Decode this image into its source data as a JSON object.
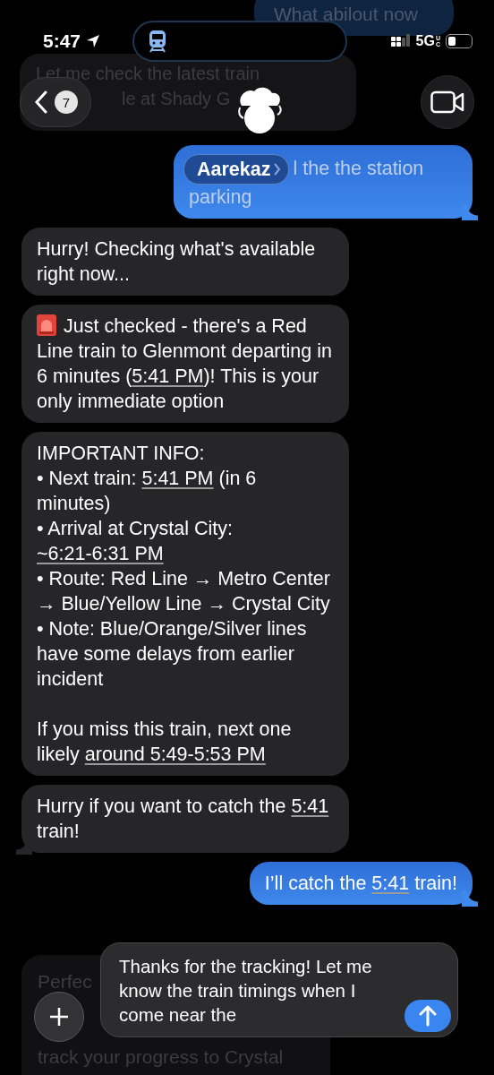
{
  "status_bar": {
    "time": "5:47",
    "network": "5G",
    "network_sub": "UC"
  },
  "faded_top_sent": {
    "text": "What abilout now"
  },
  "faded_top_received": {
    "lines": [
      "Let me check the latest train",
      "le at Shady G"
    ]
  },
  "header": {
    "unread_count": "7"
  },
  "messages": [
    {
      "kind": "sent",
      "tail": true,
      "contact": "Aarekaz",
      "groups": [
        [
          {
            "runs": [
              {
                "text": "l the the station parking"
              }
            ]
          }
        ]
      ]
    },
    {
      "kind": "received",
      "tail": false,
      "groups": [
        [
          {
            "runs": [
              {
                "text": "Hurry! Checking what's available right now..."
              }
            ]
          }
        ]
      ]
    },
    {
      "kind": "received",
      "tail": false,
      "alert": true,
      "groups": [
        [
          {
            "runs": [
              {
                "text": "Just checked - there's a Red Line train to Glenmont departing in 6 minutes ("
              },
              {
                "text": "5:41 PM",
                "link": true
              },
              {
                "text": ")! This is your only immediate option"
              }
            ]
          }
        ]
      ]
    },
    {
      "kind": "received",
      "tail": false,
      "groups": [
        [
          {
            "runs": [
              {
                "text": "IMPORTANT INFO:"
              }
            ]
          },
          {
            "runs": [
              {
                "text": "• Next train: "
              },
              {
                "text": "5:41 PM",
                "link": true
              },
              {
                "text": " (in 6 minutes)"
              }
            ]
          },
          {
            "runs": [
              {
                "text": "• Arrival at Crystal City: "
              },
              {
                "text": "~6:21-6:31 PM",
                "link": true
              }
            ]
          },
          {
            "runs": [
              {
                "text": "• Route: Red Line → Metro Center → Blue/Yellow Line → Crystal City"
              }
            ]
          },
          {
            "runs": [
              {
                "text": "• Note: Blue/Orange/Silver lines have some delays from earlier incident"
              }
            ]
          }
        ],
        [
          {
            "runs": [
              {
                "text": "If you miss this train, next one likely "
              },
              {
                "text": "around 5:49-5:53 PM",
                "link": true
              }
            ]
          }
        ]
      ]
    },
    {
      "kind": "received",
      "tail": true,
      "groups": [
        [
          {
            "runs": [
              {
                "text": "Hurry if you want to catch the "
              },
              {
                "text": "5:41",
                "link": true
              },
              {
                "text": " train!"
              }
            ]
          }
        ]
      ]
    },
    {
      "kind": "sent",
      "tail": true,
      "groups": [
        [
          {
            "runs": [
              {
                "text": "I’ll catch the "
              },
              {
                "text": "5:41",
                "link": true
              },
              {
                "text": " train!"
              }
            ]
          }
        ]
      ]
    }
  ],
  "faded_bottom": {
    "lines": [
      "Perfec",
      "track your progress to Crystal"
    ]
  },
  "composer": {
    "value": "Thanks for the tracking! Let me know the train timings when I come near the"
  }
}
